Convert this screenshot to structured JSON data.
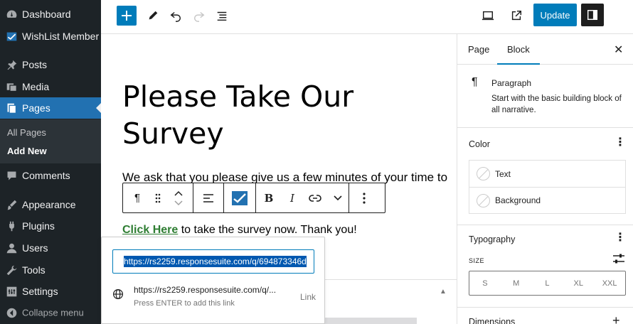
{
  "admin_menu": {
    "items": [
      {
        "label": "Dashboard",
        "icon": "dashboard-icon"
      },
      {
        "label": "WishList Member",
        "icon": "wishlist-icon"
      },
      {
        "label": "Posts",
        "icon": "pin-icon"
      },
      {
        "label": "Media",
        "icon": "media-icon"
      },
      {
        "label": "Pages",
        "icon": "pages-icon"
      },
      {
        "label": "Comments",
        "icon": "comments-icon"
      },
      {
        "label": "Appearance",
        "icon": "brush-icon"
      },
      {
        "label": "Plugins",
        "icon": "plug-icon"
      },
      {
        "label": "Users",
        "icon": "users-icon"
      },
      {
        "label": "Tools",
        "icon": "wrench-icon"
      },
      {
        "label": "Settings",
        "icon": "settings-icon"
      }
    ],
    "submenu": [
      "All Pages",
      "Add New"
    ],
    "collapse_label": "Collapse menu"
  },
  "topbar": {
    "update_label": "Update"
  },
  "content": {
    "title": "Please Take Our Survey",
    "para1": "We ask that you please give us a few minutes of your time to",
    "link_text": "Click Here",
    "para2_rest": " to take the survey now. Thank you!"
  },
  "block_toolbar": {
    "bold": "B",
    "italic": "I"
  },
  "link_popover": {
    "input_value": "https://rs2259.responsesuite.com/q/694873346d",
    "suggestion_url": "https://rs2259.responsesuite.com/q/...",
    "suggestion_hint": "Press ENTER to add this link",
    "suggestion_type": "Link"
  },
  "sidebar": {
    "tabs": [
      "Page",
      "Block"
    ],
    "block_name": "Paragraph",
    "block_desc": "Start with the basic building block of all narrative.",
    "color_title": "Color",
    "color_items": [
      "Text",
      "Background"
    ],
    "typography_title": "Typography",
    "size_label": "SIZE",
    "sizes": [
      "S",
      "M",
      "L",
      "XL",
      "XXL"
    ],
    "dimensions_title": "Dimensions"
  },
  "colors": {
    "admin_bg": "#1d2327",
    "accent": "#007cba",
    "current_menu": "#2271b1",
    "link_green": "#2e7d32"
  }
}
